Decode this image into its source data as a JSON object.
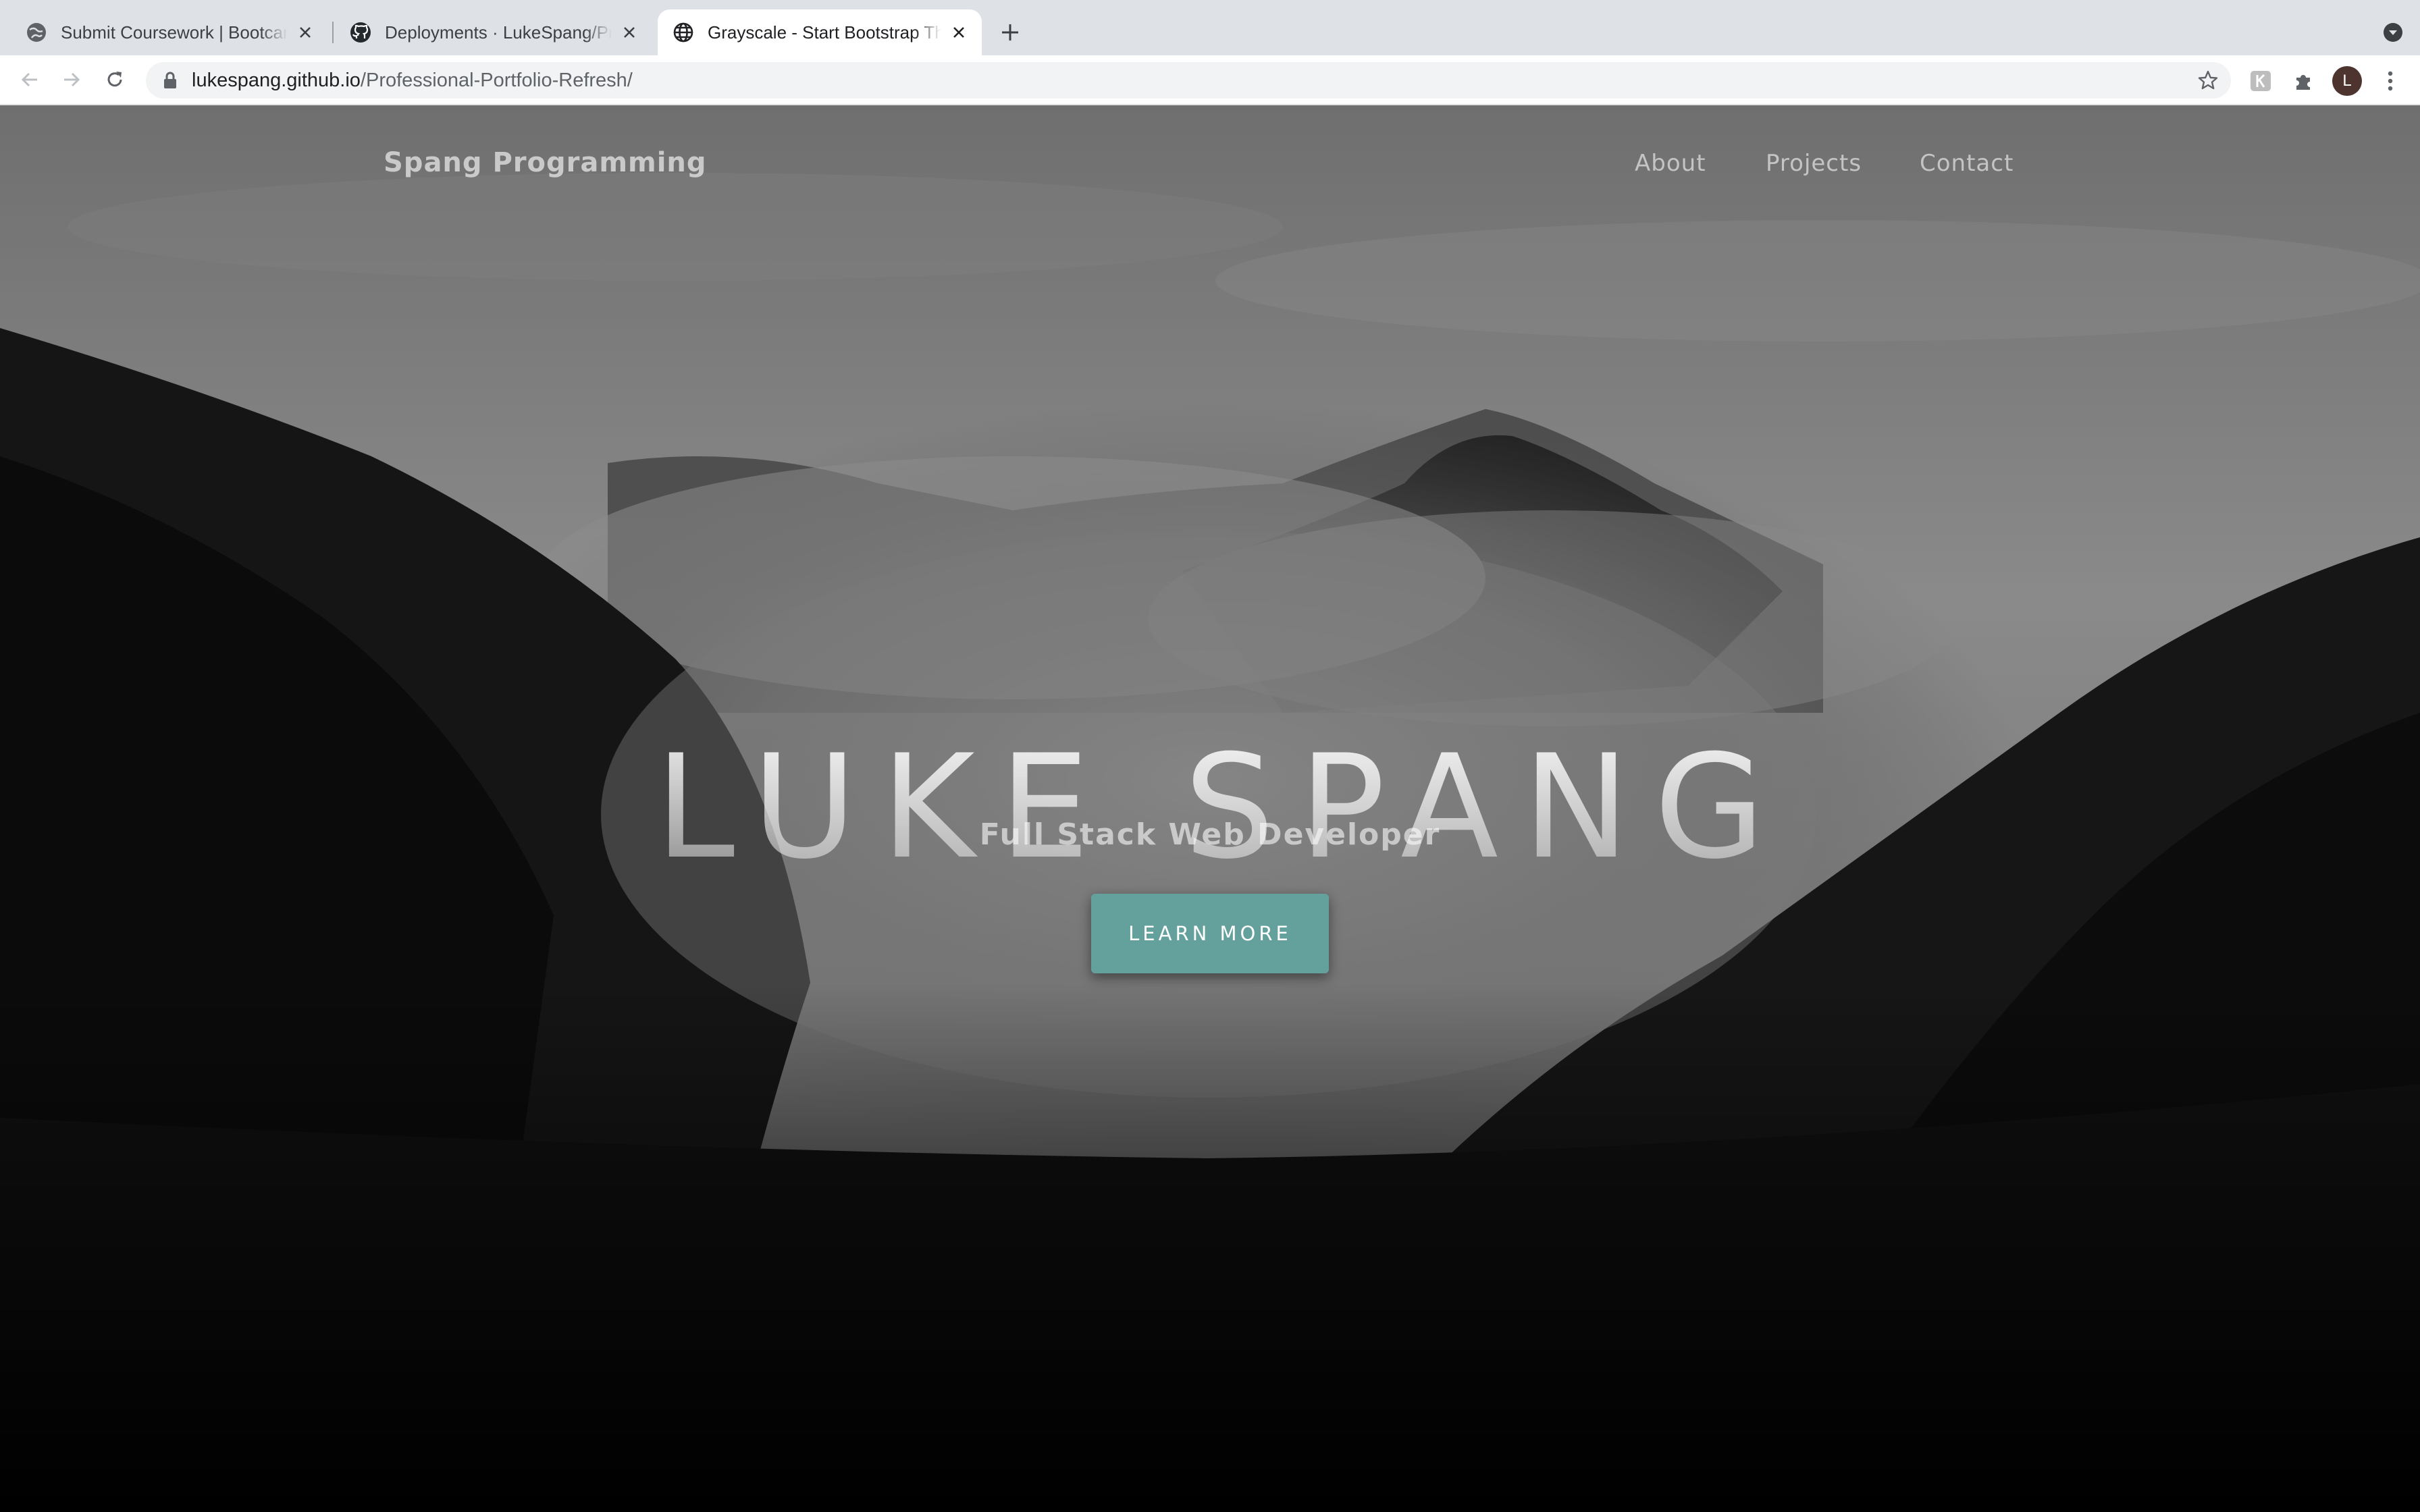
{
  "browser": {
    "tabs": [
      {
        "title": "Submit Coursework | Bootcamp Spot",
        "favicon": "globe-dark-icon",
        "active": false
      },
      {
        "title": "Deployments · LukeSpang/Professional-Portfolio-Refresh",
        "favicon": "github-icon",
        "active": false
      },
      {
        "title": "Grayscale - Start Bootstrap Theme",
        "favicon": "globe-icon",
        "active": true
      }
    ],
    "address": {
      "host": "lukespang.github.io",
      "path": "/Professional-Portfolio-Refresh/"
    },
    "avatar_initial": "L",
    "icons": [
      "back-arrow-icon",
      "forward-arrow-icon",
      "reload-icon",
      "lock-icon",
      "star-icon",
      "extension-k-icon",
      "puzzle-extensions-icon",
      "kebab-menu-icon",
      "tab-search-icon",
      "new-tab-plus-icon"
    ]
  },
  "site": {
    "brand": "Spang Programming",
    "nav": [
      {
        "label": "About"
      },
      {
        "label": "Projects"
      },
      {
        "label": "Contact"
      }
    ],
    "hero": {
      "title": "LUKE SPANG",
      "subtitle": "Full Stack Web Developer",
      "button": "LEARN MORE"
    }
  },
  "colors": {
    "button_bg": "#64a19d",
    "tabbar_bg": "#dee1e6",
    "omnibox_bg": "#f1f3f4",
    "page_bg": "#000000"
  }
}
